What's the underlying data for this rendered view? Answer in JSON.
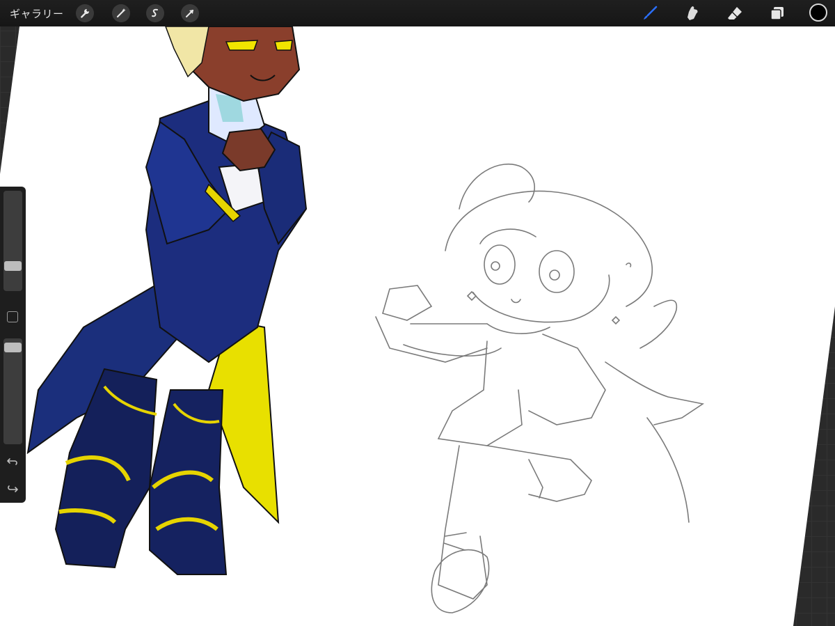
{
  "app": {
    "gallery_label": "ギャラリー"
  },
  "toolbar": {
    "left_tools": [
      {
        "name": "actions",
        "icon": "wrench-icon"
      },
      {
        "name": "adjustments",
        "icon": "magic-wand-icon"
      },
      {
        "name": "selection",
        "icon": "selection-s-icon"
      },
      {
        "name": "transform",
        "icon": "arrow-cursor-icon"
      }
    ],
    "right_tools": [
      {
        "name": "brush",
        "icon": "brush-icon",
        "active": true
      },
      {
        "name": "smudge",
        "icon": "smudge-finger-icon"
      },
      {
        "name": "eraser",
        "icon": "eraser-icon"
      },
      {
        "name": "layers",
        "icon": "layers-icon"
      }
    ],
    "current_color": "#000000",
    "active_color": "#2b6fff"
  },
  "sidebar": {
    "brush_size_level": 0.72,
    "opacity_level": 0.04,
    "icons": [
      "square-modify-icon",
      "undo-icon",
      "redo-icon"
    ]
  },
  "canvas": {
    "paper_color": "#ffffff",
    "content": [
      "colored-character-illustration",
      "pencil-sketch-chibi-character"
    ]
  }
}
